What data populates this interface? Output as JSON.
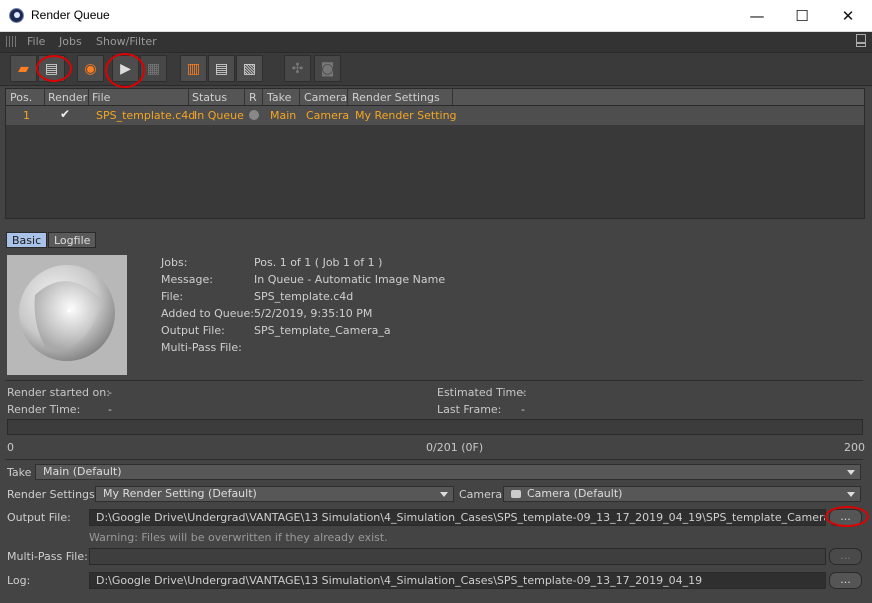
{
  "window": {
    "title": "Render Queue",
    "minimize": "—",
    "maximize": "☐",
    "close": "✕"
  },
  "menu": {
    "items": [
      "File",
      "Jobs",
      "Show/Filter"
    ]
  },
  "toolbar": {
    "icons": [
      "open-folder-icon",
      "add-document-icon",
      "render-settings-icon",
      "start-render-icon",
      "render-multi-icon",
      "trash-icon",
      "delete-list-icon",
      "export-list-icon",
      "render-net-icon",
      "camera-icon"
    ]
  },
  "list": {
    "headers": [
      "Pos.",
      "Render",
      "File",
      "Status",
      "R",
      "Take",
      "Camera",
      "Render Settings"
    ],
    "rows": [
      {
        "pos": "1",
        "render": "✔",
        "file": "SPS_template.c4d",
        "status": "In Queue",
        "take": "Main",
        "camera": "Camera",
        "render_settings": "My Render Setting"
      }
    ]
  },
  "tabs": [
    "Basic",
    "Logfile"
  ],
  "info": {
    "jobs_label": "Jobs:",
    "jobs": "Pos. 1 of 1 ( Job 1 of 1 )",
    "message_label": "Message:",
    "message": "In Queue - Automatic Image Name",
    "file_label": "File:",
    "file": "SPS_template.c4d",
    "added_label": "Added to Queue:",
    "added": "5/2/2019, 9:35:10 PM",
    "output_label": "Output File:",
    "output": "SPS_template_Camera_a",
    "multipass_label": "Multi-Pass File:",
    "multipass": ""
  },
  "stats": {
    "started_label": "Render started on:",
    "started": "-",
    "time_label": "Render Time:",
    "time": "-",
    "estimated_label": "Estimated Time:",
    "estimated": "-",
    "last_frame_label": "Last Frame:",
    "last_frame": "-"
  },
  "progress": {
    "start": "0",
    "center": "0/201 (0F)",
    "end": "200",
    "fraction": 0
  },
  "settings": {
    "take_label": "Take",
    "take_value": "Main (Default)",
    "render_settings_label": "Render Settings",
    "render_settings_value": "My Render Setting (Default)",
    "camera_label": "Camera",
    "camera_value": "Camera (Default)",
    "output_label": "Output File:",
    "output_value": "D:\\Google Drive\\Undergrad\\VANTAGE\\13 Simulation\\4_Simulation_Cases\\SPS_template-09_13_17_2019_04_19\\SPS_template_Camera_a",
    "browse": "...",
    "warning": "Warning: Files will be overwritten if they already exist.",
    "multipass_label": "Multi-Pass File:",
    "multipass_value": "",
    "log_label": "Log:",
    "log_value": "D:\\Google Drive\\Undergrad\\VANTAGE\\13 Simulation\\4_Simulation_Cases\\SPS_template-09_13_17_2019_04_19"
  },
  "colors": {
    "accent": "#f5a623",
    "tab_active": "#a9c3e8",
    "annotation": "#e00000"
  }
}
